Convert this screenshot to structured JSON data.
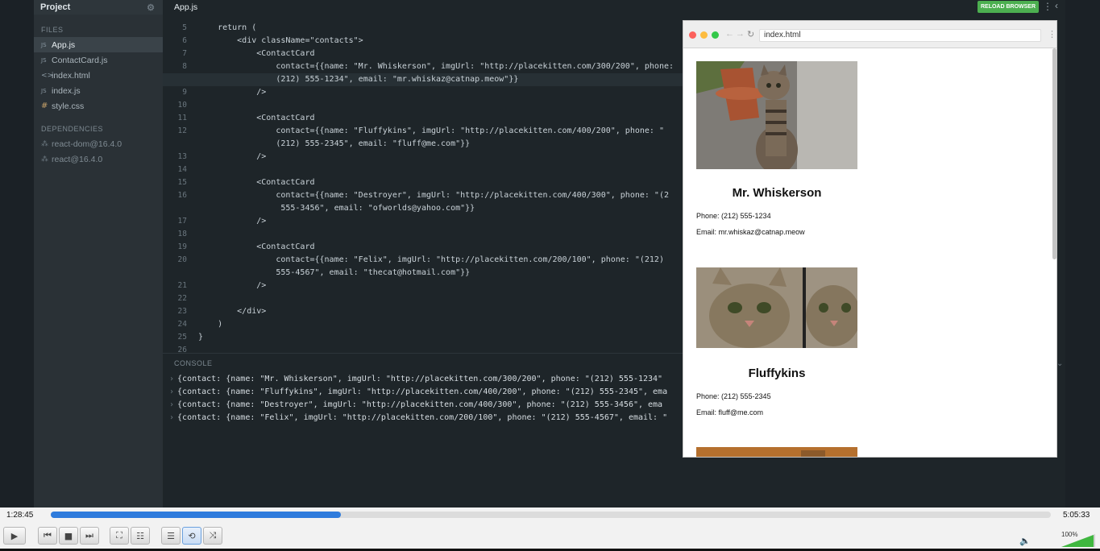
{
  "sidebar": {
    "title": "Project",
    "files_heading": "FILES",
    "files": [
      {
        "icon": "js-icon",
        "glyph": "JS",
        "label": "App.js",
        "active": true
      },
      {
        "icon": "js-icon",
        "glyph": "JS",
        "label": "ContactCard.js"
      },
      {
        "icon": "html-icon",
        "glyph": "<>",
        "label": "index.html"
      },
      {
        "icon": "js-icon",
        "glyph": "JS",
        "label": "index.js"
      },
      {
        "icon": "css-icon",
        "glyph": "#",
        "label": "style.css"
      }
    ],
    "deps_heading": "DEPENDENCIES",
    "deps": [
      {
        "label": "react-dom@16.4.0"
      },
      {
        "label": "react@16.4.0"
      }
    ]
  },
  "editor": {
    "tab": "App.js",
    "reload_label": "RELOAD BROWSER",
    "lines": [
      {
        "n": "5",
        "text": "    return ("
      },
      {
        "n": "6",
        "text": "        <div className=\"contacts\">"
      },
      {
        "n": "7",
        "text": "            <ContactCard"
      },
      {
        "n": "8",
        "text": "                contact={{name: \"Mr. Whiskerson\", imgUrl: \"http://placekitten.com/300/200\", phone:"
      },
      {
        "n": "",
        "text": "                (212) 555-1234\", email: \"mr.whiskaz@catnap.meow\"}}",
        "highlight": true
      },
      {
        "n": "9",
        "text": "            />"
      },
      {
        "n": "10",
        "text": ""
      },
      {
        "n": "11",
        "text": "            <ContactCard"
      },
      {
        "n": "12",
        "text": "                contact={{name: \"Fluffykins\", imgUrl: \"http://placekitten.com/400/200\", phone: \""
      },
      {
        "n": "",
        "text": "                (212) 555-2345\", email: \"fluff@me.com\"}}"
      },
      {
        "n": "13",
        "text": "            />"
      },
      {
        "n": "14",
        "text": ""
      },
      {
        "n": "15",
        "text": "            <ContactCard"
      },
      {
        "n": "16",
        "text": "                contact={{name: \"Destroyer\", imgUrl: \"http://placekitten.com/400/300\", phone: \"(2"
      },
      {
        "n": "",
        "text": "                 555-3456\", email: \"ofworlds@yahoo.com\"}}"
      },
      {
        "n": "17",
        "text": "            />"
      },
      {
        "n": "18",
        "text": ""
      },
      {
        "n": "19",
        "text": "            <ContactCard"
      },
      {
        "n": "20",
        "text": "                contact={{name: \"Felix\", imgUrl: \"http://placekitten.com/200/100\", phone: \"(212)"
      },
      {
        "n": "",
        "text": "                555-4567\", email: \"thecat@hotmail.com\"}}"
      },
      {
        "n": "21",
        "text": "            />"
      },
      {
        "n": "22",
        "text": ""
      },
      {
        "n": "23",
        "text": "        </div>"
      },
      {
        "n": "24",
        "text": "    )"
      },
      {
        "n": "25",
        "text": "}"
      },
      {
        "n": "26",
        "text": ""
      }
    ]
  },
  "console": {
    "title": "CONSOLE",
    "lines": [
      "{contact: {name: \"Mr. Whiskerson\", imgUrl: \"http://placekitten.com/300/200\", phone: \"(212) 555-1234\"",
      "{contact: {name: \"Fluffykins\", imgUrl: \"http://placekitten.com/400/200\", phone: \"(212) 555-2345\", ema",
      "{contact: {name: \"Destroyer\", imgUrl: \"http://placekitten.com/400/300\", phone: \"(212) 555-3456\", ema",
      "{contact: {name: \"Felix\", imgUrl: \"http://placekitten.com/200/100\", phone: \"(212) 555-4567\", email: \""
    ]
  },
  "browser": {
    "url": "index.html",
    "cards": [
      {
        "name": "Mr. Whiskerson",
        "phone": "Phone: (212) 555-1234",
        "email": "Email: mr.whiskaz@catnap.meow"
      },
      {
        "name": "Fluffykins",
        "phone": "Phone: (212) 555-2345",
        "email": "Email: fluff@me.com"
      }
    ]
  },
  "player": {
    "elapsed": "1:28:45",
    "total": "5:05:33",
    "progress": 0.29,
    "volume": "100%",
    "accent": "#2e7bdc"
  }
}
